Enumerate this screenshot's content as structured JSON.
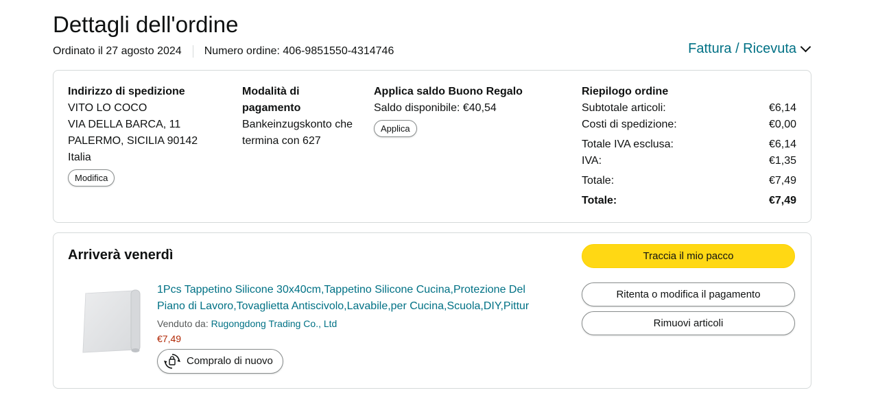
{
  "header": {
    "title": "Dettagli dell'ordine",
    "ordered_on": "Ordinato il 27 agosto 2024",
    "order_number": "Numero ordine: 406-9851550-4314746",
    "invoice_link": "Fattura / Ricevuta"
  },
  "shipping": {
    "heading": "Indirizzo di spedizione",
    "lines": [
      "VITO LO COCO",
      "VIA DELLA BARCA, 11",
      "PALERMO, SICILIA 90142",
      "Italia"
    ],
    "edit_label": "Modifica"
  },
  "payment": {
    "heading_line1": "Modalità di",
    "heading_line2": "pagamento",
    "method_line1": "Bankeinzugskonto che",
    "method_line2": "termina con 627"
  },
  "gift_card": {
    "heading": "Applica saldo Buono Regalo",
    "balance": "Saldo disponibile: €40,54",
    "apply_label": "Applica"
  },
  "summary": {
    "heading": "Riepilogo ordine",
    "rows": [
      {
        "label": "Subtotale articoli:",
        "value": "€6,14"
      },
      {
        "label": "Costi di spedizione:",
        "value": "€0,00"
      },
      {
        "label": "Totale IVA esclusa:",
        "value": "€6,14"
      },
      {
        "label": "IVA:",
        "value": "€1,35"
      },
      {
        "label": "Totale:",
        "value": "€7,49"
      },
      {
        "label": "Totale:",
        "value": "€7,49"
      }
    ]
  },
  "shipment": {
    "arrival": "Arriverà venerdì",
    "product_title_line1": "1Pcs Tappetino Silicone 30x40cm,Tappetino Silicone Cucina,Protezione Del",
    "product_title_line2": "Piano di Lavoro,Tovaglietta Antiscivolo,Lavabile,per Cucina,Scuola,DIY,Pittur",
    "sold_by_label": "Venduto da:",
    "seller": "Rugongdong Trading Co., Ltd",
    "price": "€7,49",
    "buy_again_label": "Compralo di nuovo",
    "track_label": "Traccia il mio pacco",
    "retry_payment_label": "Ritenta o modifica il pagamento",
    "remove_items_label": "Rimuovi articoli"
  },
  "colors": {
    "link": "#007185",
    "primary_button": "#ffd814",
    "price": "#b12704",
    "border": "#d5d9d9"
  },
  "icons": {
    "invoice_chevron": "chevron-down-icon",
    "buy_again": "buy-again-icon",
    "product_image": "silicone-mat-thumbnail"
  }
}
